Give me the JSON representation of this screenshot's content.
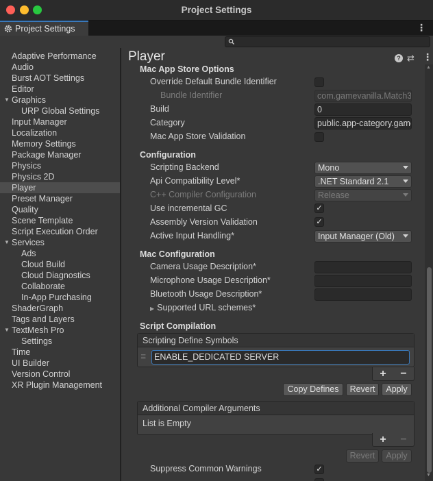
{
  "window": {
    "title": "Project Settings"
  },
  "tab": {
    "label": "Project Settings",
    "icon": "gear-icon"
  },
  "search": {
    "value": "",
    "placeholder": ""
  },
  "sidebar": {
    "items": [
      {
        "label": "Adaptive Performance"
      },
      {
        "label": "Audio"
      },
      {
        "label": "Burst AOT Settings"
      },
      {
        "label": "Editor"
      },
      {
        "label": "Graphics"
      },
      {
        "label": "URP Global Settings"
      },
      {
        "label": "Input Manager"
      },
      {
        "label": "Localization"
      },
      {
        "label": "Memory Settings"
      },
      {
        "label": "Package Manager"
      },
      {
        "label": "Physics"
      },
      {
        "label": "Physics 2D"
      },
      {
        "label": "Player"
      },
      {
        "label": "Preset Manager"
      },
      {
        "label": "Quality"
      },
      {
        "label": "Scene Template"
      },
      {
        "label": "Script Execution Order"
      },
      {
        "label": "Services"
      },
      {
        "label": "Ads"
      },
      {
        "label": "Cloud Build"
      },
      {
        "label": "Cloud Diagnostics"
      },
      {
        "label": "Collaborate"
      },
      {
        "label": "In-App Purchasing"
      },
      {
        "label": "ShaderGraph"
      },
      {
        "label": "Tags and Layers"
      },
      {
        "label": "TextMesh Pro"
      },
      {
        "label": "Settings"
      },
      {
        "label": "Time"
      },
      {
        "label": "UI Builder"
      },
      {
        "label": "Version Control"
      },
      {
        "label": "XR Plugin Management"
      }
    ]
  },
  "panel": {
    "title": "Player"
  },
  "mac_app_store": {
    "title": "Mac App Store Options",
    "override_bundle_label": "Override Default Bundle Identifier",
    "bundle_id_label": "Bundle Identifier",
    "bundle_id_value": "com.gamevanilla.Match3",
    "build_label": "Build",
    "build_value": "0",
    "category_label": "Category",
    "category_value": "public.app-category.games",
    "validation_label": "Mac App Store Validation"
  },
  "configuration": {
    "title": "Configuration",
    "scripting_backend_label": "Scripting Backend",
    "scripting_backend_value": "Mono",
    "api_level_label": "Api Compatibility Level*",
    "api_level_value": ".NET Standard 2.1",
    "cpp_config_label": "C++ Compiler Configuration",
    "cpp_config_value": "Release",
    "incremental_gc_label": "Use incremental GC",
    "assembly_validation_label": "Assembly Version Validation",
    "input_handling_label": "Active Input Handling*",
    "input_handling_value": "Input Manager (Old)"
  },
  "mac_configuration": {
    "title": "Mac Configuration",
    "camera_label": "Camera Usage Description*",
    "camera_value": "",
    "microphone_label": "Microphone Usage Description*",
    "microphone_value": "",
    "bluetooth_label": "Bluetooth Usage Description*",
    "bluetooth_value": "",
    "url_schemes_label": "Supported URL schemes*"
  },
  "script_compilation": {
    "title": "Script Compilation",
    "define_symbols_header": "Scripting Define Symbols",
    "define_symbol_value": "ENABLE_DEDICATED SERVER",
    "add_label": "+",
    "remove_label": "−",
    "copy_defines_label": "Copy Defines",
    "revert_label": "Revert",
    "apply_label": "Apply",
    "compiler_args_header": "Additional Compiler Arguments",
    "compiler_args_empty": "List is Empty",
    "suppress_warnings_label": "Suppress Common Warnings"
  },
  "checkbox_glyph": "✓"
}
